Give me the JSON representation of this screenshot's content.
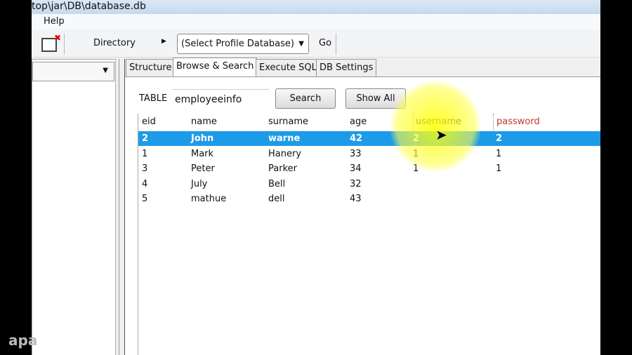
{
  "window": {
    "title": "top\\jar\\DB\\database.db"
  },
  "menu": {
    "help": "Help"
  },
  "toolbar": {
    "directory": "Directory",
    "profile_select": "(Select Profile Database)",
    "go": "Go"
  },
  "tabs": [
    "Structure",
    "Browse & Search",
    "Execute SQL",
    "DB Settings"
  ],
  "browse": {
    "table_label": "TABLE",
    "table_value": "employeeinfo",
    "search": "Search",
    "show_all": "Show All"
  },
  "grid": {
    "columns": [
      "eid",
      "name",
      "surname",
      "age",
      "username",
      "password"
    ],
    "rows": [
      [
        "2",
        "John",
        "warne",
        "42",
        "2",
        "2"
      ],
      [
        "1",
        "Mark",
        "Hanery",
        "33",
        "1",
        "1"
      ],
      [
        "3",
        "Peter",
        "Parker",
        "34",
        "1",
        "1"
      ],
      [
        "4",
        "July",
        "Bell",
        "32",
        "",
        ""
      ],
      [
        "5",
        "mathue",
        "dell",
        "43",
        "",
        ""
      ]
    ],
    "selected_row": 0
  },
  "watermark": "apa",
  "colors": {
    "selection": "#1e9be8",
    "password_header": "#c0392b",
    "highlight": "#ffff00"
  }
}
